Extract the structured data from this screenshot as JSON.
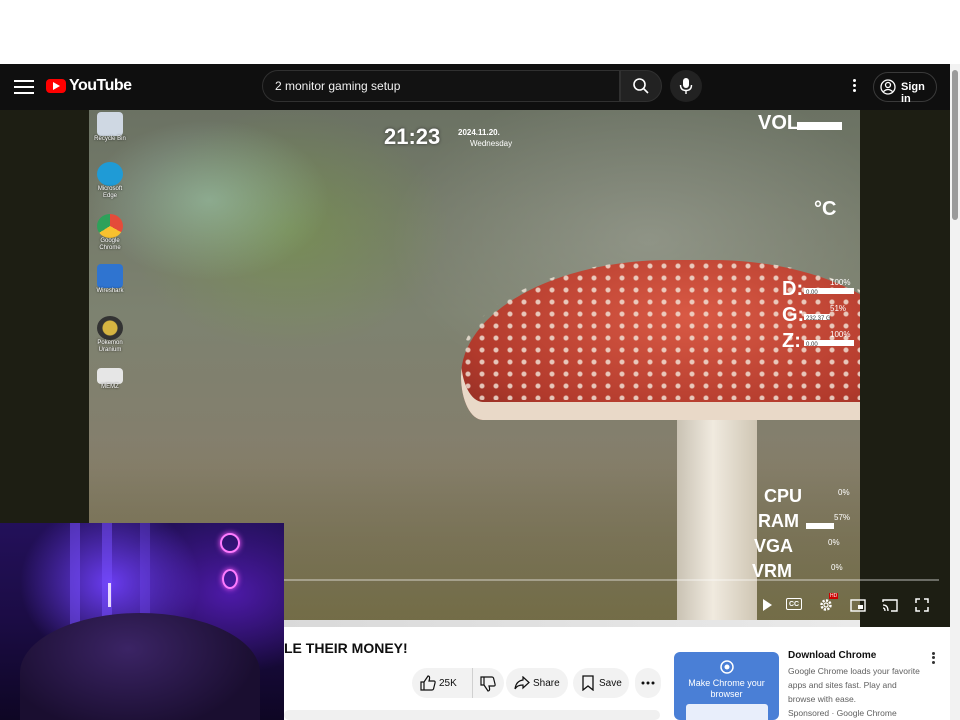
{
  "header": {
    "logo_text": "YouTube",
    "search_value": "2 monitor gaming setup",
    "signin_label": "Sign in"
  },
  "desktop": {
    "icons": [
      {
        "label": "Recycle Bin",
        "color": "#cfd8e3"
      },
      {
        "label": "Microsoft Edge",
        "color": "#1f9bd6"
      },
      {
        "label": "Google Chrome",
        "color": "#e44b3a"
      },
      {
        "label": "Wireshark",
        "color": "#2f74d0"
      },
      {
        "label": "Pokemon Uranium",
        "color": "#d6b441"
      },
      {
        "label": "MEMZ",
        "color": "#e6e6e6"
      }
    ]
  },
  "overlay": {
    "time": "21:23",
    "date": "2024.11.20.",
    "weekday": "Wednesday",
    "vol_label": "VOL",
    "temp_label": "°C",
    "drives": [
      {
        "letter": "D:",
        "pct": "100%",
        "sub": "0.00"
      },
      {
        "letter": "G:",
        "pct": "51%",
        "sub": "232.37 G"
      },
      {
        "letter": "Z:",
        "pct": "100%",
        "sub": "0.00"
      }
    ],
    "system": [
      {
        "label": "CPU",
        "pct": "0%",
        "fill": 0.0
      },
      {
        "label": "RAM",
        "pct": "57%",
        "fill": 0.57
      },
      {
        "label": "VGA",
        "pct": "0%",
        "fill": 0.0
      },
      {
        "label": "VRM",
        "pct": "0%",
        "fill": 0.0
      }
    ]
  },
  "player": {
    "cc_label": "CC",
    "settings_badge": "HD"
  },
  "video": {
    "title": "LE THEIR MONEY!",
    "like_count": "25K",
    "share_label": "Share",
    "save_label": "Save"
  },
  "ad": {
    "thumb_text": "Make Chrome your browser",
    "title": "Download Chrome",
    "description": "Google Chrome loads your favorite apps and sites fast. Play and browse with ease.",
    "sponsored": "Sponsored · Google Chrome"
  },
  "colors": {
    "yt_red": "#ff0000",
    "header_bg": "#0f0f0f",
    "neon": "#ff7bff"
  }
}
